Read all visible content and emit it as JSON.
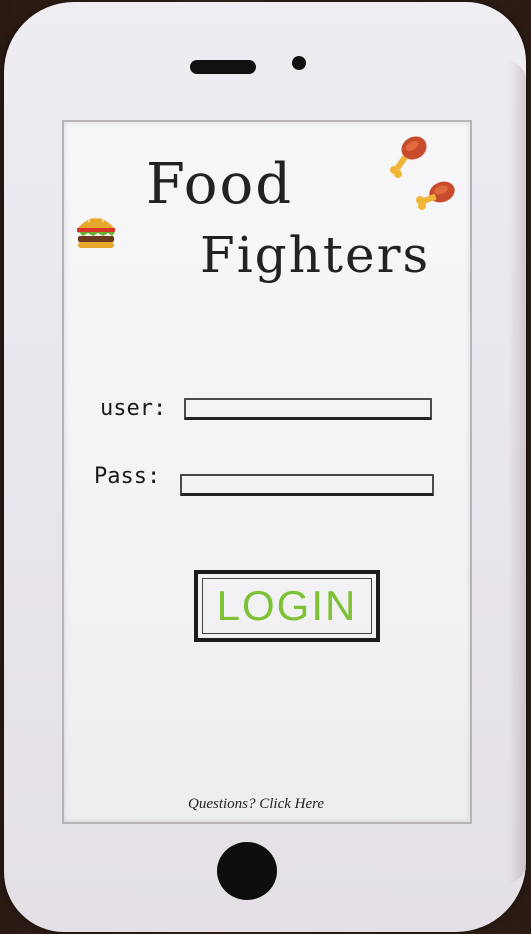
{
  "app": {
    "title_line1": "Food",
    "title_line2": "Fighters"
  },
  "icons": {
    "burger": "burger-icon",
    "drumstick": "drumstick-icon"
  },
  "form": {
    "user_label": "user:",
    "user_value": "",
    "pass_label": "Pass:",
    "pass_value": ""
  },
  "actions": {
    "login_label": "LOGIN",
    "help_link": "Questions? Click Here"
  },
  "colors": {
    "login_text": "#7cc234",
    "background": "#2a1a14"
  }
}
